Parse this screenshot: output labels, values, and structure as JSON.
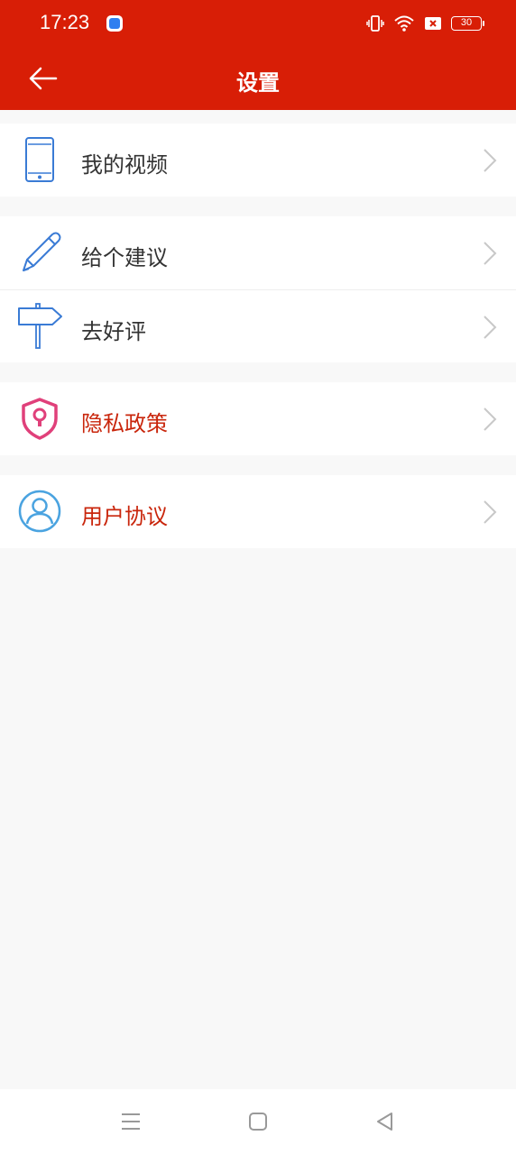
{
  "status_bar": {
    "time": "17:23",
    "battery": "30"
  },
  "app_bar": {
    "title": "设置"
  },
  "groups": [
    {
      "items": [
        {
          "label": "我的视频",
          "icon": "phone-icon"
        }
      ]
    },
    {
      "items": [
        {
          "label": "给个建议",
          "icon": "pen-icon"
        },
        {
          "label": "去好评",
          "icon": "signpost-icon"
        }
      ]
    },
    {
      "items": [
        {
          "label": "隐私政策",
          "icon": "shield-lock-icon"
        }
      ]
    },
    {
      "items": [
        {
          "label": "用户协议",
          "icon": "user-icon"
        }
      ]
    }
  ],
  "colors": {
    "primary": "#d81e06",
    "link_red": "#c9260c",
    "icon_blue": "#3a7bd5",
    "icon_pink": "#e0407a",
    "icon_lightblue": "#4aa3e0"
  }
}
